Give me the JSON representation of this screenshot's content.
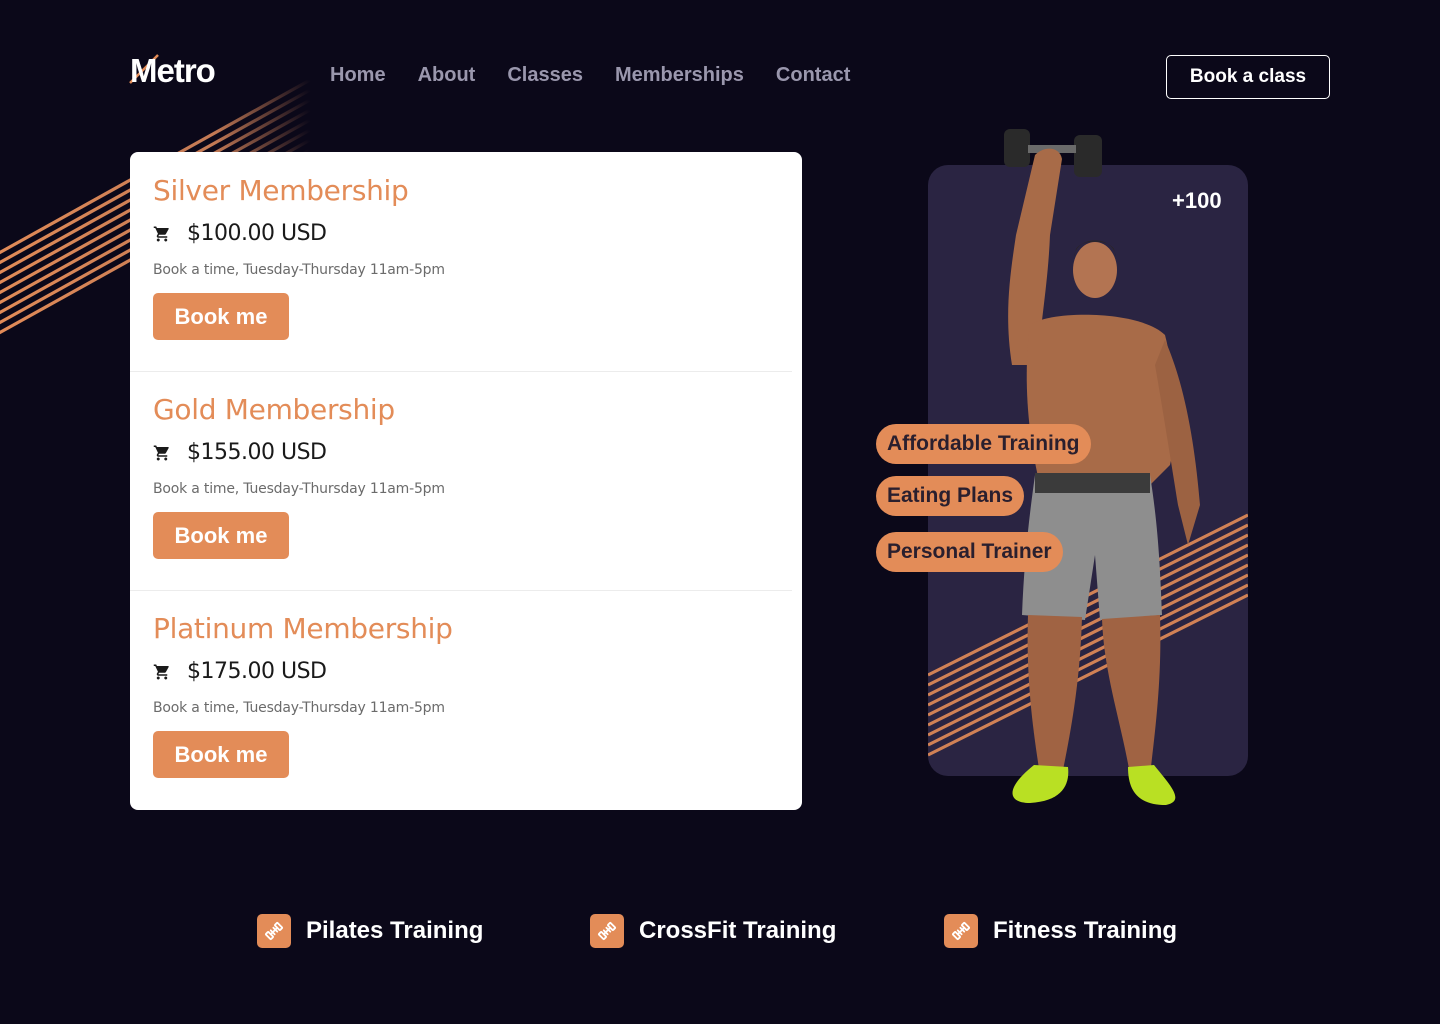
{
  "brand": {
    "name": "Metro",
    "accent": "#e38c58",
    "background": "#0b0819",
    "panel": "#2a2442"
  },
  "nav": {
    "items": [
      {
        "label": "Home"
      },
      {
        "label": "About"
      },
      {
        "label": "Classes"
      },
      {
        "label": "Memberships"
      },
      {
        "label": "Contact"
      }
    ],
    "cta_label": "Book a class"
  },
  "memberships": [
    {
      "title": "Silver Membership",
      "price": "$100.00 USD",
      "description": "Book a time, Tuesday-Thursday 11am-5pm",
      "button_label": "Book me",
      "icon": "cart-icon"
    },
    {
      "title": "Gold Membership",
      "price": "$155.00 USD",
      "description": "Book a time, Tuesday-Thursday 11am-5pm",
      "button_label": "Book me",
      "icon": "cart-icon"
    },
    {
      "title": "Platinum Membership",
      "price": "$175.00 USD",
      "description": "Book a time, Tuesday-Thursday 11am-5pm",
      "button_label": "Book me",
      "icon": "cart-icon"
    }
  ],
  "hero": {
    "count": "+100",
    "tags": [
      "Affordable Training",
      "Eating Plans",
      "Personal Trainer"
    ]
  },
  "features": [
    {
      "label": "Pilates Training",
      "icon": "dumbbell-icon"
    },
    {
      "label": "CrossFit Training",
      "icon": "dumbbell-icon"
    },
    {
      "label": "Fitness Training",
      "icon": "dumbbell-icon"
    }
  ]
}
